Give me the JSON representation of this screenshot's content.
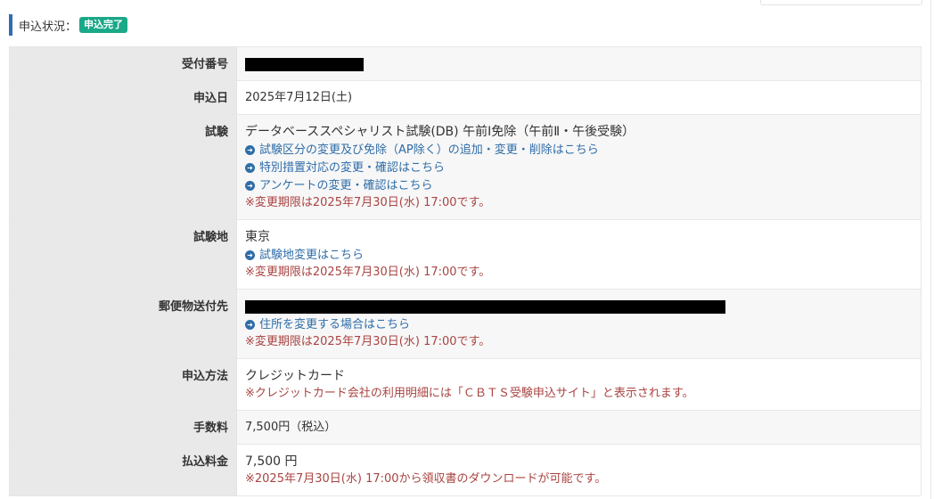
{
  "status": {
    "label": "申込状況：",
    "badge": "申込完了"
  },
  "rows": {
    "receipt": {
      "label": "受付番号"
    },
    "date": {
      "label": "申込日",
      "value": "2025年7月12日(土)"
    },
    "exam": {
      "label": "試験",
      "value": "データベーススペシャリスト試験(DB) 午前Ⅰ免除（午前Ⅱ・午後受験）",
      "link1": "試験区分の変更及び免除（AP除く）の追加・変更・削除はこちら",
      "link2": "特別措置対応の変更・確認はこちら",
      "link3": "アンケートの変更・確認はこちら",
      "note": "※変更期限は2025年7月30日(水) 17:00です。"
    },
    "site": {
      "label": "試験地",
      "value": "東京",
      "link": "試験地変更はこちら",
      "note": "※変更期限は2025年7月30日(水) 17:00です。"
    },
    "mail": {
      "label": "郵便物送付先",
      "link": "住所を変更する場合はこちら",
      "note": "※変更期限は2025年7月30日(水) 17:00です。"
    },
    "method": {
      "label": "申込方法",
      "value": "クレジットカード",
      "note": "※クレジットカード会社の利用明細には「ＣＢＴＳ受験申込サイト」と表示されます。"
    },
    "fee": {
      "label": "手数料",
      "value": "7,500円（税込）"
    },
    "paid": {
      "label": "払込料金",
      "value": "7,500 円",
      "note": "※2025年7月30日(水) 17:00から領収書のダウンロードが可能です。"
    }
  },
  "icons": {
    "link_icon": "circle-arrow-right-icon"
  },
  "colors": {
    "accent": "#2f6db5",
    "badge": "#1aa888",
    "link": "#2f6da8",
    "note": "#a94442"
  }
}
